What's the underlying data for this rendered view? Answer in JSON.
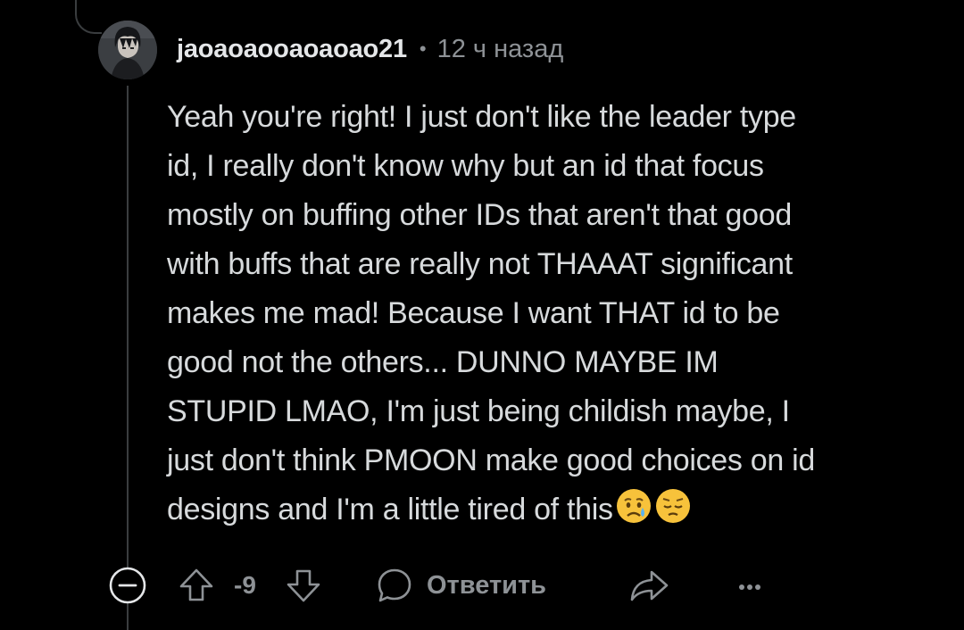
{
  "comment": {
    "username": "jaoaoaooaoaoao21",
    "separator": "•",
    "timestamp": "12 ч назад",
    "body_lines": [
      "Yeah you're right! I just don't like the leader type",
      "id, I really don't know why but an id that focus",
      "mostly on buffing other IDs that aren't that good",
      "with buffs that are really not THAAAT significant",
      "makes me mad! Because I want THAT id to be",
      "good not the others... DUNNO MAYBE IM",
      "STUPID LMAO, I'm just being childish maybe, I",
      "just don't think PMOON make good choices on id",
      "designs and I'm a little tired of this"
    ],
    "emojis": [
      "sad-relieved-face-emoji",
      "pensive-face-emoji"
    ]
  },
  "actions": {
    "score": "-9",
    "reply_label": "Ответить",
    "icons": {
      "collapse": "minus-circle-icon",
      "upvote": "arrow-up-icon",
      "downvote": "arrow-down-icon",
      "reply": "speech-bubble-icon",
      "share": "share-arrow-icon",
      "more": "more-dots-icon"
    }
  },
  "colors": {
    "background": "#000000",
    "text": "#d7dadc",
    "meta": "#8e9296",
    "thread_line": "#3a3d3f"
  }
}
